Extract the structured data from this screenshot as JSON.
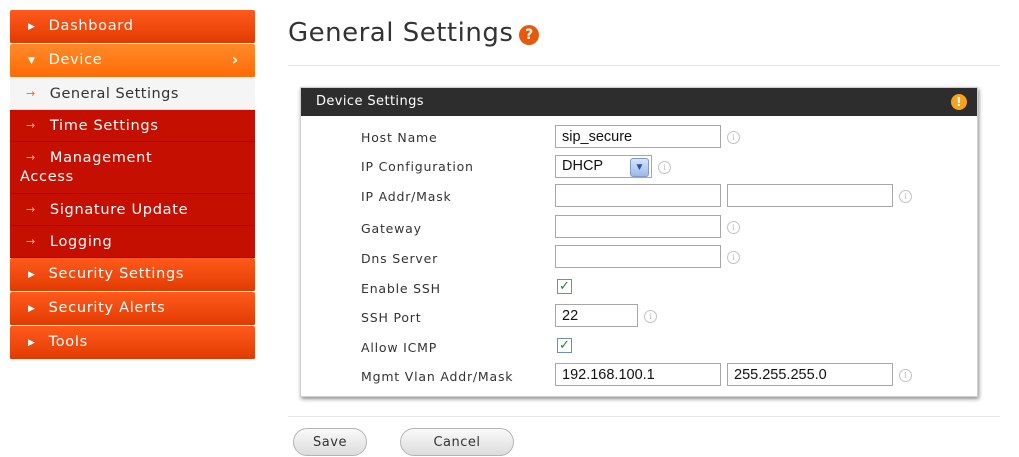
{
  "sidebar": {
    "dashboard": "Dashboard",
    "device": "Device",
    "device_sub": [
      "General Settings",
      "Time Settings",
      "Management",
      "Access",
      "Signature Update",
      "Logging"
    ],
    "security_settings": "Security Settings",
    "security_alerts": "Security Alerts",
    "tools": "Tools"
  },
  "page": {
    "title": "General Settings",
    "help_icon": "?"
  },
  "panel": {
    "title": "Device Settings",
    "info_icon": "!",
    "fields": {
      "host_name_label": "Host Name",
      "host_name_value": "sip_secure",
      "ip_config_label": "IP Configuration",
      "ip_config_value": "DHCP",
      "ip_addr_label": "IP Addr/Mask",
      "ip_addr_value": "",
      "ip_mask_value": "",
      "gateway_label": "Gateway",
      "gateway_value": "",
      "dns_label": "Dns Server",
      "dns_value": "",
      "enable_ssh_label": "Enable SSH",
      "enable_ssh_checked": true,
      "ssh_port_label": "SSH Port",
      "ssh_port_value": "22",
      "allow_icmp_label": "Allow ICMP",
      "allow_icmp_checked": true,
      "mgmt_vlan_label": "Mgmt Vlan Addr/Mask",
      "mgmt_vlan_addr": "192.168.100.1",
      "mgmt_vlan_mask": "255.255.255.0"
    }
  },
  "actions": {
    "save": "Save",
    "cancel": "Cancel"
  },
  "colors": {
    "accent": "#ff6a05",
    "sidebar_sub": "#c50f00",
    "panel_header": "#2d2d2d"
  },
  "icons": {
    "info": "info-circle-icon",
    "check": "checkmark-icon",
    "dropdown": "chevron-down-icon"
  }
}
